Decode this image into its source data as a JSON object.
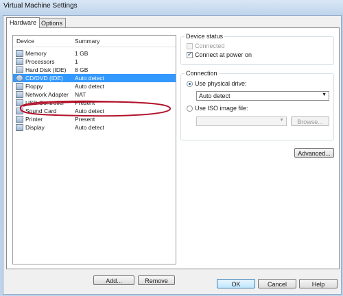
{
  "window": {
    "title": "Virtual Machine Settings"
  },
  "tabs": [
    {
      "label": "Hardware",
      "active": true
    },
    {
      "label": "Options",
      "active": false
    }
  ],
  "device_list": {
    "columns": {
      "device": "Device",
      "summary": "Summary"
    },
    "rows": [
      {
        "icon": "memory-icon",
        "device": "Memory",
        "summary": "1 GB"
      },
      {
        "icon": "processor-icon",
        "device": "Processors",
        "summary": "1"
      },
      {
        "icon": "hard-disk-icon",
        "device": "Hard Disk (IDE)",
        "summary": "8 GB"
      },
      {
        "icon": "cd-dvd-icon",
        "device": "CD/DVD (IDE)",
        "summary": "Auto detect",
        "selected": true
      },
      {
        "icon": "floppy-icon",
        "device": "Floppy",
        "summary": "Auto detect"
      },
      {
        "icon": "network-adapter-icon",
        "device": "Network Adapter",
        "summary": "NAT"
      },
      {
        "icon": "usb-controller-icon",
        "device": "USB Controller",
        "summary": "Present"
      },
      {
        "icon": "sound-card-icon",
        "device": "Sound Card",
        "summary": "Auto detect"
      },
      {
        "icon": "printer-icon",
        "device": "Printer",
        "summary": "Present"
      },
      {
        "icon": "display-icon",
        "device": "Display",
        "summary": "Auto detect"
      }
    ]
  },
  "list_buttons": {
    "add": "Add...",
    "remove": "Remove"
  },
  "device_status": {
    "legend": "Device status",
    "connected": {
      "label": "Connected",
      "checked": false,
      "enabled": false
    },
    "connect_at_power_on": {
      "label": "Connect at power on",
      "checked": true
    }
  },
  "connection": {
    "legend": "Connection",
    "use_physical_drive": {
      "label": "Use physical drive:",
      "selected": true
    },
    "physical_drive_value": "Auto detect",
    "use_iso_image": {
      "label": "Use ISO image file:",
      "selected": false
    },
    "iso_path_value": "",
    "browse_label": "Browse..."
  },
  "advanced_label": "Advanced...",
  "dialog_buttons": {
    "ok": "OK",
    "cancel": "Cancel",
    "help": "Help"
  },
  "colors": {
    "selection": "#3399ff",
    "annotation": "#b3122a"
  }
}
